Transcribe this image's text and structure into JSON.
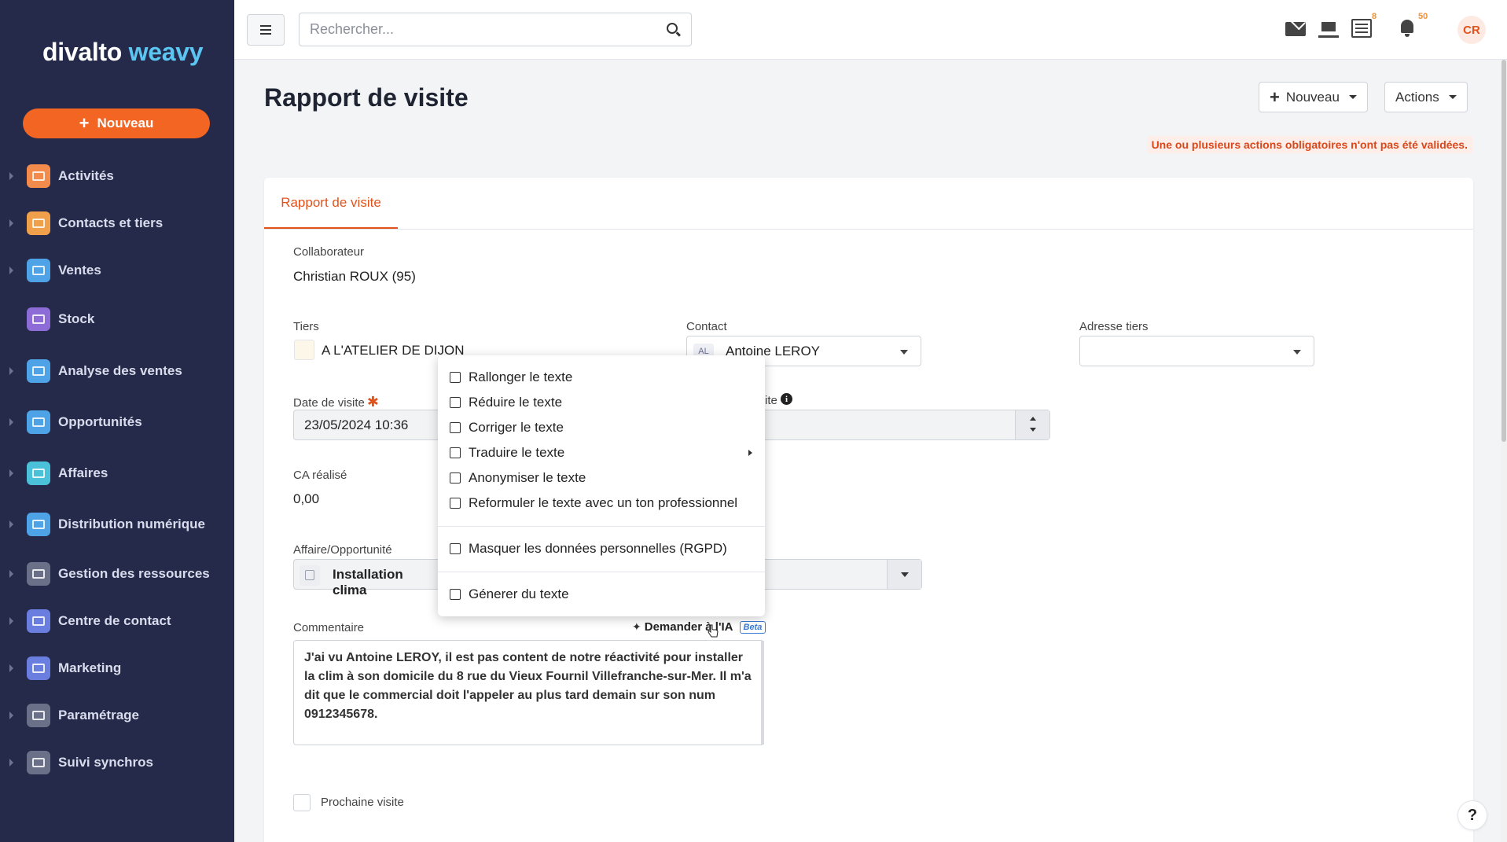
{
  "brand": {
    "name_part1": "divalto",
    "name_part2": "weavy"
  },
  "sidebar": {
    "new_button": "Nouveau",
    "items": [
      {
        "label": "Activités",
        "color": "#f28b4b",
        "icon": "people-icon"
      },
      {
        "label": "Contacts et tiers",
        "color": "#f0a04a",
        "icon": "contact-card-icon"
      },
      {
        "label": "Ventes",
        "color": "#4ea3e6",
        "icon": "money-icon"
      },
      {
        "label": "Stock",
        "color": "#8e6cd8",
        "icon": "warehouse-icon"
      },
      {
        "label": "Analyse des ventes",
        "color": "#4ea3e6",
        "icon": "pie-chart-icon"
      },
      {
        "label": "Opportunités",
        "color": "#4ea3e6",
        "icon": "briefcase-icon"
      },
      {
        "label": "Affaires",
        "color": "#4bc0d9",
        "icon": "case-icon"
      },
      {
        "label": "Distribution numérique",
        "color": "#4ea3e6",
        "icon": "line-chart-icon"
      },
      {
        "label": "Gestion des ressources",
        "color": "#6b7089",
        "icon": "org-chart-icon"
      },
      {
        "label": "Centre de contact",
        "color": "#6a7ee0",
        "icon": "phone-icon"
      },
      {
        "label": "Marketing",
        "color": "#6a7ee0",
        "icon": "megaphone-icon"
      },
      {
        "label": "Paramétrage",
        "color": "#6b7089",
        "icon": "gear-icon"
      },
      {
        "label": "Suivi synchros",
        "color": "#6b7089",
        "icon": "bar-chart-icon"
      }
    ]
  },
  "topbar": {
    "search_placeholder": "Rechercher...",
    "list_badge": "8",
    "bell_badge": "50",
    "avatar": "CR"
  },
  "header": {
    "title": "Rapport de visite",
    "new_button": "Nouveau",
    "actions_button": "Actions",
    "warning": "Une ou plusieurs actions obligatoires n'ont pas été validées."
  },
  "form": {
    "tab": "Rapport de visite",
    "collaborateur_label": "Collaborateur",
    "collaborateur_value": "Christian ROUX (95)",
    "tiers_label": "Tiers",
    "tiers_value": "A L'ATELIER DE DIJON",
    "contact_label": "Contact",
    "contact_initials": "AL",
    "contact_value": "Antoine LEROY",
    "adresse_label": "Adresse tiers",
    "date_label": "Date de visite",
    "date_value": "23/05/2024 10:36",
    "duree_label_fragment": "ite",
    "ca_label": "CA réalisé",
    "ca_value": "0,00",
    "affaire_label": "Affaire/Opportunité",
    "affaire_value": "Installation clima",
    "commentaire_label": "Commentaire",
    "ia_button": "Demander à l'IA",
    "ia_beta": "Beta",
    "commentaire_value": "J'ai vu Antoine LEROY, il est pas content de notre réactivité pour installer la clim à son domicile du 8 rue du Vieux Fournil Villefranche-sur-Mer. Il m'a dit que le commercial doit l'appeler au plus tard demain sur son num 0912345678.",
    "prochaine_visite": "Prochaine visite"
  },
  "context_menu": {
    "items": [
      {
        "label": "Rallonger le texte",
        "icon": "expand-text-icon"
      },
      {
        "label": "Réduire le texte",
        "icon": "shrink-text-icon"
      },
      {
        "label": "Corriger le texte",
        "icon": "spellcheck-icon"
      },
      {
        "label": "Traduire le texte",
        "icon": "translate-icon",
        "submenu": true
      },
      {
        "label": "Anonymiser le texte",
        "icon": "anonymous-icon"
      },
      {
        "label": "Reformuler le texte avec un ton professionnel",
        "icon": "tie-icon"
      },
      {
        "label": "Masquer les données personnelles (RGPD)",
        "icon": "pencil-icon"
      },
      {
        "label": "Génerer du texte",
        "icon": "pen-icon"
      }
    ]
  },
  "colors": {
    "accent": "#e2531c",
    "sidebar_bg": "#252a4a",
    "brand_blue": "#5cc6f2",
    "new_button": "#f26522"
  }
}
